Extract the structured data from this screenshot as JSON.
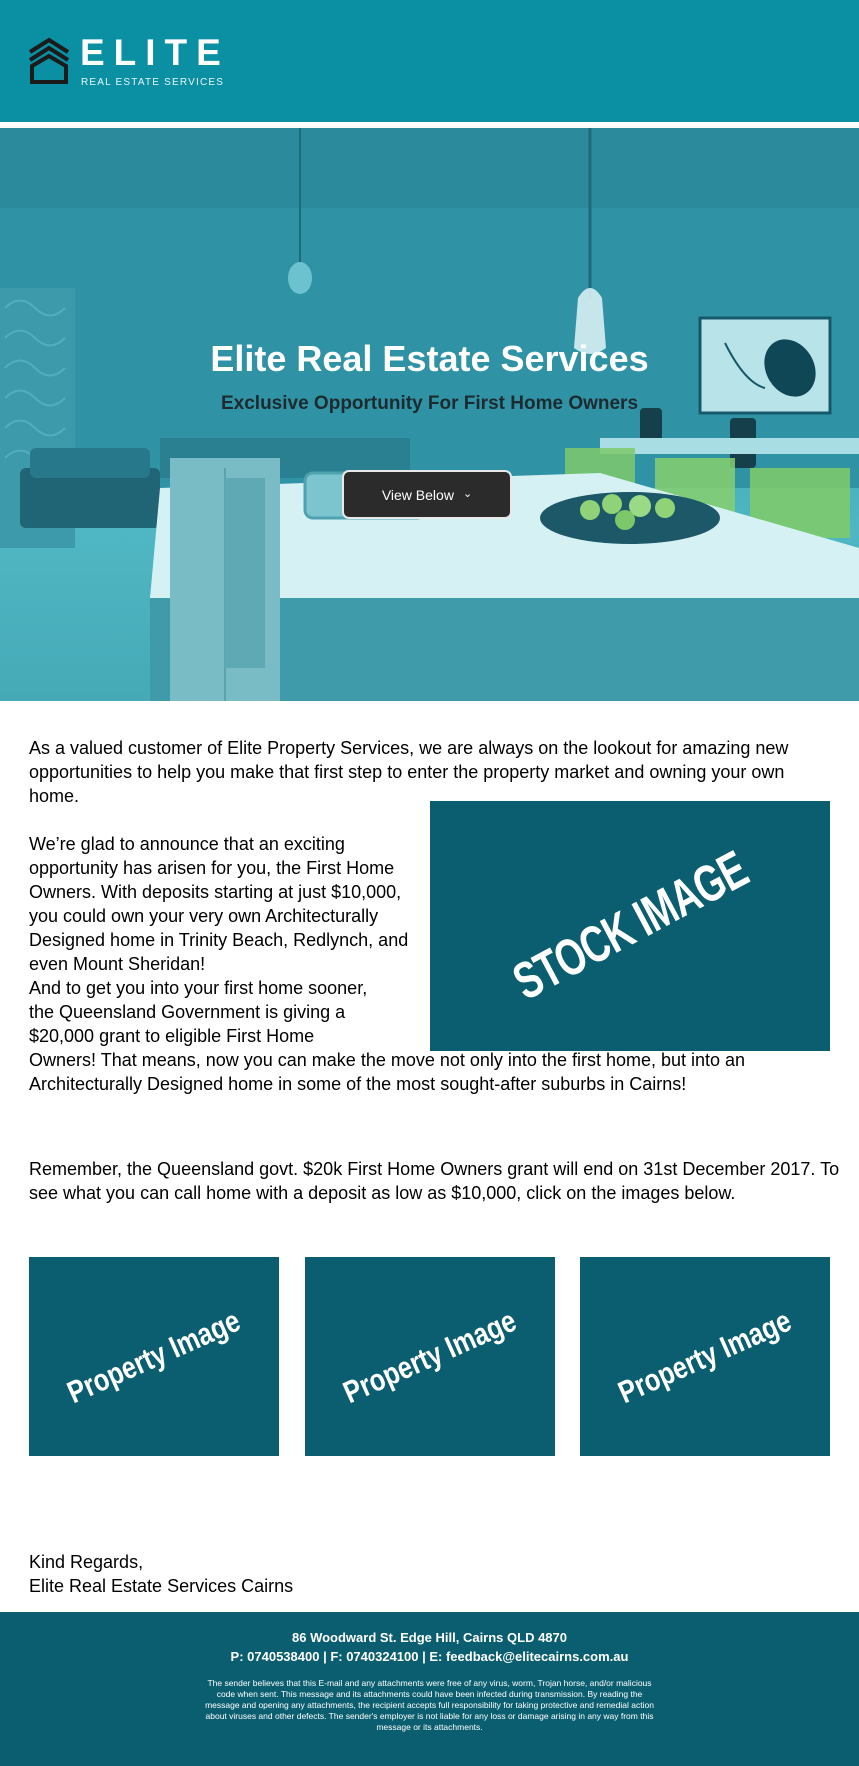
{
  "brand": {
    "name": "ELITE",
    "tagline": "REAL ESTATE SERVICES",
    "header_color": "#0a8fa3"
  },
  "hero": {
    "title": "Elite Real Estate Services",
    "subtitle": "Exclusive Opportunity For First Home Owners",
    "button_label": "View Below",
    "button_icon": "chevron-down-icon"
  },
  "body": {
    "intro": "As a valued customer of Elite Property Services, we are always on the lookout for amazing new opportunities to help you make that first step to enter the property market and owning your own home.",
    "announce": "We’re glad to announce that an exciting opportunity has arisen for you, the First Home Owners.  With deposits starting at just $10,000, you could own your very own Architecturally Designed home in Trinity Beach, Redlynch, and even Mount Sheridan!",
    "grant_lines": [
      "And to get you into your first home sooner,",
      "the Queensland Government is giving a",
      "$20,000 grant to eligible First Home"
    ],
    "grant_tail": "Owners!  That means, now you can make the move not only into the first home, but into an Architecturally Designed home in some of the most sought-after suburbs in Cairns!",
    "reminder": "Remember, the Queensland govt. $20k First Home Owners grant will end on 31st December 2017. To see what you can call home with a deposit as low as $10,000, click on the images below.",
    "stock_image_label": "STOCK IMAGE",
    "property_images": [
      "Property Image",
      "Property Image",
      "Property Image"
    ],
    "signoff": [
      "Kind Regards,",
      "Elite Real Estate Services Cairns"
    ],
    "placeholder_color": "#0b5e6f"
  },
  "footer": {
    "address": "86 Woodward St. Edge Hill, Cairns QLD 4870",
    "contact": "P: 0740538400 | F: 0740324100 | E: feedback@elitecairns.com.au",
    "disclaimer": "The sender believes that this E-mail and any attachments were free of any virus, worm, Trojan horse, and/or malicious code when sent. This message and its attachments could have been infected during transmission. By reading the message and opening any attachments, the recipient accepts full responsibility for taking protective and remedial action about viruses and other defects. The sender's employer is not liable for any loss or damage arising in any way from this message or its attachments."
  }
}
